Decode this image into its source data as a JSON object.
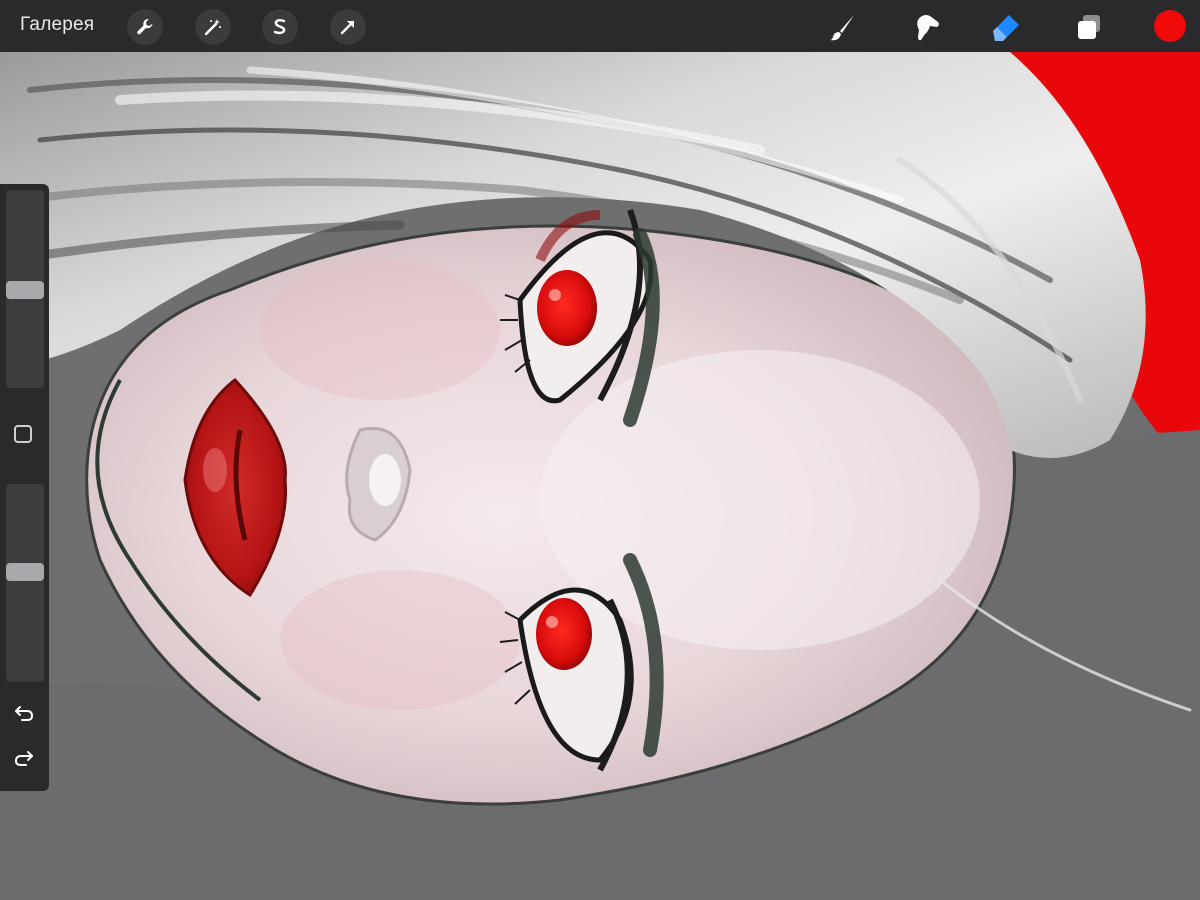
{
  "app": {
    "gallery_label": "Галерея"
  },
  "toolbar": {
    "left_tools": [
      "wrench-icon",
      "magic-wand-icon",
      "selection-icon",
      "transform-arrow-icon"
    ],
    "right_tools": [
      "brush-icon",
      "smudge-icon",
      "eraser-icon",
      "layers-icon"
    ],
    "active_tool": "eraser-icon",
    "current_color": "#f00a0a"
  },
  "sidebar": {
    "brush_size": 0.34,
    "brush_opacity": 0.44,
    "icons": [
      "modify-square-icon",
      "undo-icon",
      "redo-icon"
    ]
  },
  "colors": {
    "toolbar_bg": "#2a2a2c",
    "accent_blue": "#1e88ff",
    "canvas_red": "#e8070a",
    "canvas_gray": "#6f6f71"
  }
}
